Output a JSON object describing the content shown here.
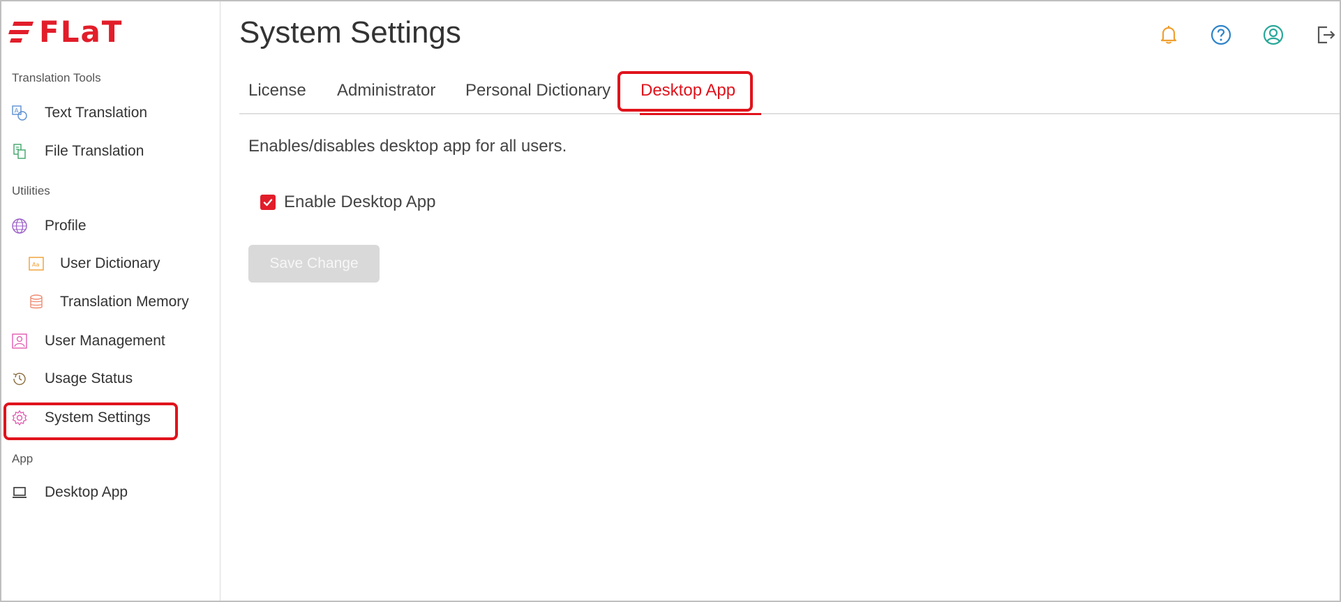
{
  "brand": {
    "logo_text": "FLaT",
    "accent": "#e0131c"
  },
  "sidebar": {
    "sections": [
      {
        "label": "Translation Tools"
      },
      {
        "label": "Utilities"
      },
      {
        "label": "App"
      }
    ],
    "items": [
      {
        "label": "Text Translation",
        "icon": "text-translation-icon"
      },
      {
        "label": "File Translation",
        "icon": "file-translation-icon"
      },
      {
        "label": "Profile",
        "icon": "globe-icon"
      },
      {
        "label": "User Dictionary",
        "icon": "dictionary-icon"
      },
      {
        "label": "Translation Memory",
        "icon": "database-icon"
      },
      {
        "label": "User Management",
        "icon": "user-management-icon"
      },
      {
        "label": "Usage Status",
        "icon": "history-icon"
      },
      {
        "label": "System Settings",
        "icon": "gear-icon"
      },
      {
        "label": "Desktop App",
        "icon": "laptop-icon"
      }
    ]
  },
  "header": {
    "title": "System Settings",
    "icons": [
      "bell-icon",
      "help-icon",
      "account-icon",
      "logout-icon"
    ]
  },
  "tabs": [
    {
      "label": "License"
    },
    {
      "label": "Administrator"
    },
    {
      "label": "Personal Dictionary"
    },
    {
      "label": "Desktop App",
      "active": true
    }
  ],
  "content": {
    "description": "Enables/disables desktop app for all users.",
    "checkbox_label": "Enable Desktop App",
    "checkbox_checked": true,
    "save_label": "Save Change"
  }
}
